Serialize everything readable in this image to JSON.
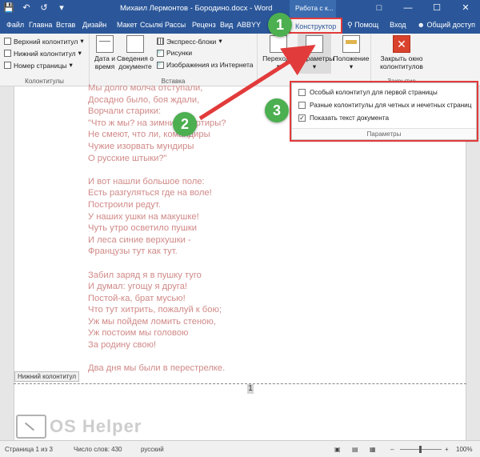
{
  "titlebar": {
    "doc_title": "Михаил Лермонтов - Бородино.docx  -  Word",
    "context_tab_title": "Работа с к...",
    "save_icon": "save-icon",
    "undo_icon": "undo-icon",
    "redo_icon": "redo-icon",
    "accent": "#2b579a"
  },
  "tabs": {
    "file": "Файл",
    "home": "Главна",
    "insert": "Встав",
    "design": "Дизайн",
    "layout": "Макет",
    "references": "Ссылкі",
    "mailings": "Рассы",
    "review": "Реценз",
    "view": "Вид",
    "abbyy": "ABBYY",
    "constructor": "Конструктор",
    "help": "Помощ",
    "signin": "Вход",
    "share": "Общий доступ"
  },
  "ribbon": {
    "header": "Верхний колонтитул",
    "footer": "Нижний колонтитул",
    "page_number": "Номер страницы",
    "group_headers": "Колонтитулы",
    "date_time_line1": "Дата и",
    "date_time_line2": "время",
    "doc_info_line1": "Сведения о",
    "doc_info_line2": "документе",
    "quick_parts": "Экспресс-блоки",
    "pictures": "Рисунки",
    "online_pictures": "Изображения из Интернета",
    "group_insert": "Вставка",
    "navigation": "Переходы",
    "parameters": "Параметры",
    "position": "Положение",
    "close_line1": "Закрыть окно",
    "close_line2": "колонтитулов",
    "group_close": "Закрытие"
  },
  "params_panel": {
    "first_page": "Особый колонтитул для первой страницы",
    "odd_even": "Разные колонтитулы для четных и нечетных страниц",
    "show_text": "Показать текст документа",
    "footer_label": "Параметры",
    "first_page_checked": false,
    "odd_even_checked": false,
    "show_text_checked": true
  },
  "document": {
    "poem": "Мы долго молча отступали,\nДосадно было, боя ждали,\nВорчали старики:\n\"Что ж мы? на зимние квартиры?\nНе смеют, что ли, командиры\nЧужие изорвать мундиры\nО русские штыки?\"\n\nИ вот нашли большое поле:\nЕсть разгуляться где на воле!\nПостроили редут.\nУ наших ушки на макушке!\nЧуть утро осветило пушки\nИ леса синие верхушки -\nФранцузы тут как тут.\n\nЗабил заряд я в пушку туго\nИ думал: угощу я друга!\nПостой-ка, брат мусью!\nЧто тут хитрить, пожалуй к бою;\nУж мы пойдем ломить стеною,\nУж постоим мы головою\nЗа родину свою!\n\nДва дня мы были в перестрелке.",
    "footer_tag": "Нижний колонтитул",
    "page_number": "1",
    "text_color": "#d08a88"
  },
  "statusbar": {
    "page": "Страница 1 из 3",
    "words": "Число слов: 430",
    "language": "русский",
    "zoom": "100%"
  },
  "watermark": {
    "text": "OS Helper"
  },
  "callouts": {
    "one": "1",
    "two": "2",
    "three": "3",
    "color": "#4caf50",
    "arrow_color": "#e23b3b"
  }
}
